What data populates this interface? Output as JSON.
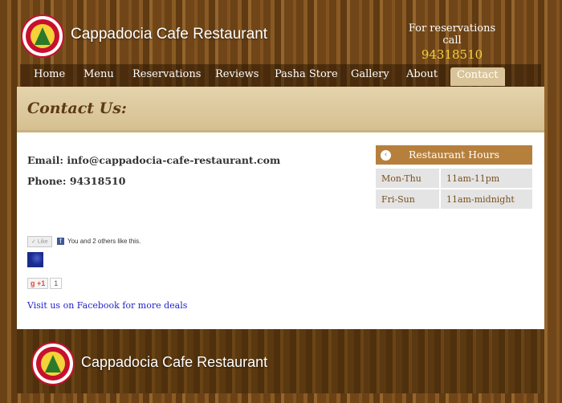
{
  "header": {
    "brand_name": "Cappadocia Cafe Restaurant",
    "reservation_label": "For reservations call",
    "reservation_phone": "94318510"
  },
  "nav": {
    "items": [
      {
        "label": "Home"
      },
      {
        "label": "Menu"
      },
      {
        "label": "Reservations"
      },
      {
        "label": "Reviews"
      },
      {
        "label": "Pasha Store"
      },
      {
        "label": "Gallery"
      },
      {
        "label": "About"
      },
      {
        "label": "Contact",
        "active": true
      }
    ]
  },
  "main": {
    "title": "Contact Us:",
    "email_line": "Email: info@cappadocia-cafe-restaurant.com",
    "phone_line": "Phone: 94318510",
    "hours": {
      "title": "Restaurant Hours",
      "toggle_icon": "‹",
      "rows": [
        {
          "day": "Mon-Thu",
          "time": "11am-11pm"
        },
        {
          "day": "Fri-Sun",
          "time": "11am-midnight"
        }
      ]
    },
    "like": {
      "button_label": "Like",
      "text": "You and 2 others like this."
    },
    "gplus": {
      "label": "+1",
      "count": "1"
    },
    "facebook_link": "Visit us on Facebook for more deals"
  },
  "footer": {
    "brand_name": "Cappadocia Cafe Restaurant"
  },
  "colors": {
    "accent": "#b6803c",
    "title": "#5c3a12",
    "link": "#2222cc",
    "phone_highlight": "#f4d23a"
  }
}
